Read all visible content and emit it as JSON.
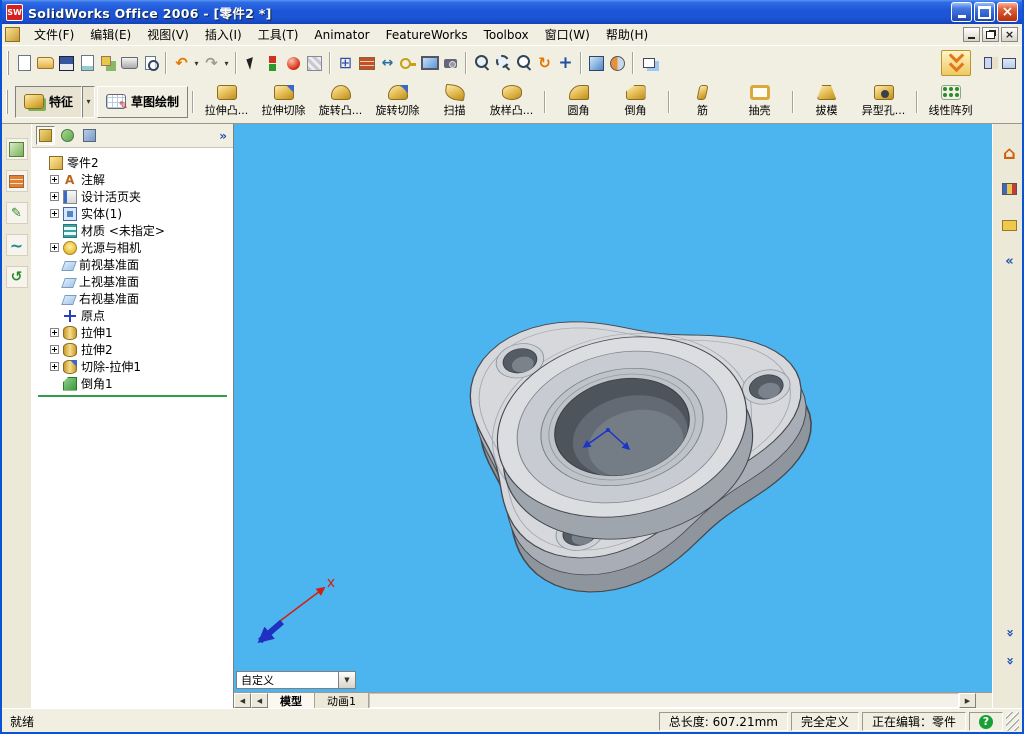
{
  "titlebar": {
    "app_icon_text": "SW",
    "title": "SolidWorks Office 2006 - [零件2 *]"
  },
  "menubar": {
    "items": [
      "文件(F)",
      "编辑(E)",
      "视图(V)",
      "插入(I)",
      "工具(T)",
      "Animator",
      "FeatureWorks",
      "Toolbox",
      "窗口(W)",
      "帮助(H)"
    ]
  },
  "std_toolbar": {
    "icons": [
      "new-document",
      "open",
      "save",
      "make-drawing-from-part",
      "make-assembly-from-part",
      "print",
      "print-preview",
      "undo",
      "redo",
      "select",
      "rebuild",
      "edit-color",
      "texture",
      "grid",
      "brick-texture",
      "dimension",
      "key",
      "screen-capture",
      "camera",
      "zoom-to-fit",
      "zoom-to-area",
      "zoom-in-out",
      "rotate-view",
      "pan",
      "shaded-view",
      "section-view",
      "cascade-windows",
      "task-pane-chevron",
      "tile-windows",
      "full-screen"
    ]
  },
  "features_toolbar": {
    "features_label": "特征",
    "sketch_label": "草图绘制",
    "buttons": [
      {
        "label": "拉伸凸..."
      },
      {
        "label": "拉伸切除"
      },
      {
        "label": "旋转凸..."
      },
      {
        "label": "旋转切除"
      },
      {
        "label": "扫描"
      },
      {
        "label": "放样凸..."
      },
      {
        "label": "圆角"
      },
      {
        "label": "倒角"
      },
      {
        "label": "筋"
      },
      {
        "label": "抽壳"
      },
      {
        "label": "拔模"
      },
      {
        "label": "异型孔..."
      },
      {
        "label": "线性阵列"
      }
    ]
  },
  "feature_tree": {
    "tab_icons": [
      "feature-manager",
      "property-manager",
      "configuration-manager"
    ],
    "items": [
      {
        "label": "零件2",
        "icon": "part",
        "expand": ""
      },
      {
        "label": "注解",
        "icon": "annotations",
        "expand": "+"
      },
      {
        "label": "设计活页夹",
        "icon": "design-binder",
        "expand": "+"
      },
      {
        "label": "实体(1)",
        "icon": "solid-bodies",
        "expand": "+"
      },
      {
        "label": "材质 <未指定>",
        "icon": "material",
        "expand": ""
      },
      {
        "label": "光源与相机",
        "icon": "lights-cameras",
        "expand": "+"
      },
      {
        "label": "前视基准面",
        "icon": "plane",
        "expand": ""
      },
      {
        "label": "上视基准面",
        "icon": "plane",
        "expand": ""
      },
      {
        "label": "右视基准面",
        "icon": "plane",
        "expand": ""
      },
      {
        "label": "原点",
        "icon": "origin",
        "expand": ""
      },
      {
        "label": "拉伸1",
        "icon": "extrude",
        "expand": "+"
      },
      {
        "label": "拉伸2",
        "icon": "extrude",
        "expand": "+"
      },
      {
        "label": "切除-拉伸1",
        "icon": "cut-extrude",
        "expand": "+"
      },
      {
        "label": "倒角1",
        "icon": "chamfer",
        "expand": "",
        "selected": true
      }
    ]
  },
  "viewport": {
    "background_color": "#4CB5F0",
    "view_combo_value": "自定义",
    "tabs": [
      "模型",
      "动画1"
    ]
  },
  "statusbar": {
    "ready": "就绪",
    "total_length": "总长度: 607.21mm",
    "definition_state": "完全定义",
    "editing_state": "正在编辑：零件"
  },
  "part_colors": {
    "top": "#D6D8DC",
    "side": "#A9AEB6",
    "dark_side": "#8F959D",
    "bore": "#4E545C",
    "edge": "#44484E"
  }
}
